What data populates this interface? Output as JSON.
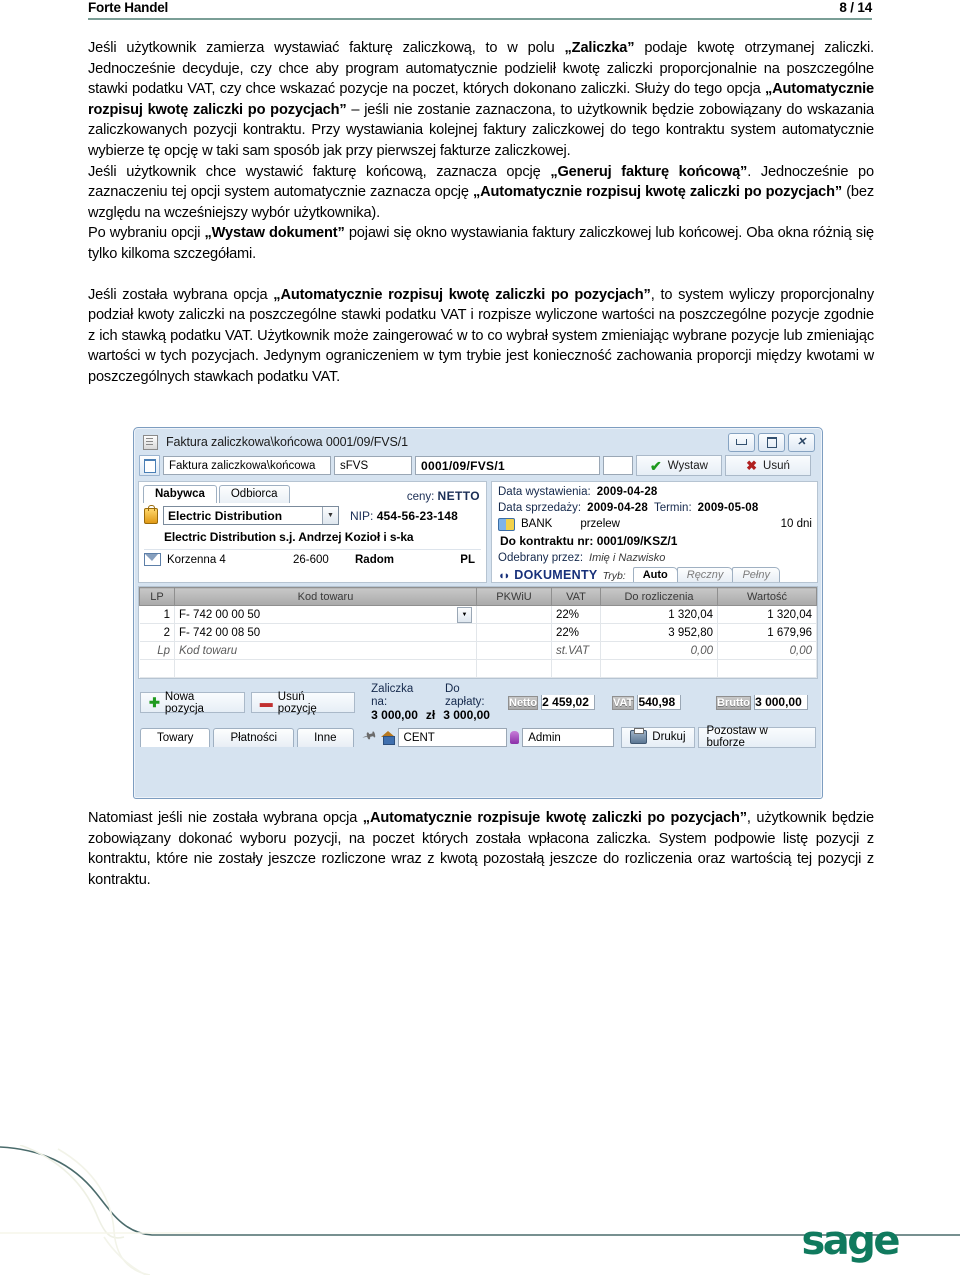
{
  "header": {
    "doc_title": "Forte Handel",
    "page_number": "8 / 14"
  },
  "paragraphs": {
    "p1_a": "Jeśli użytkownik zamierza wystawiać fakturę zaliczkową, to w polu ",
    "p1_b": "„Zaliczka”",
    "p1_c": " podaje kwotę otrzymanej zaliczki. Jednocześnie decyduje, czy chce aby program automatycznie podzielił kwotę zaliczki proporcjonalnie na poszczególne stawki podatku VAT, czy chce wskazać pozycje na poczet, których dokonano zaliczki. Służy do tego opcja ",
    "p1_d": "„Automatycznie rozpisuj kwotę zaliczki po pozycjach”",
    "p1_e": " – jeśli nie zostanie zaznaczona, to użytkownik będzie zobowiązany do wskazania zaliczkowanych pozycji kontraktu. Przy wystawiania kolejnej faktury zaliczkowej do tego kontraktu system automatycznie wybierze tę opcję w taki sam sposób jak przy pierwszej fakturze zaliczkowej.",
    "p2_a": "Jeśli użytkownik chce wystawić fakturę końcową, zaznacza opcję ",
    "p2_b": "„Generuj fakturę końcową”",
    "p2_c": ". Jednocześnie po zaznaczeniu tej opcji system automatycznie zaznacza opcję ",
    "p2_d": "„Automatycznie rozpisuj kwotę zaliczki po pozycjach”",
    "p2_e": " (bez względu na wcześniejszy wybór użytkownika).",
    "p3_a": "Po wybraniu opcji ",
    "p3_b": "„Wystaw dokument”",
    "p3_c": " pojawi się okno wystawiania faktury zaliczkowej lub końcowej. Oba okna różnią się tylko kilkoma szczegółami.",
    "p4_a": "Jeśli została wybrana opcja ",
    "p4_b": "„Automatycznie rozpisuj kwotę zaliczki po pozycjach”",
    "p4_c": ", to system wyliczy proporcjonalny podział kwoty zaliczki na poszczególne stawki podatku VAT i rozpisze wyliczone wartości na poszczególne pozycje zgodnie z ich stawką podatku VAT. Użytkownik może zaingerować w to co wybrał system zmieniając wybrane pozycje lub zmieniając wartości w tych pozycjach. Jedynym ograniczeniem w tym trybie jest konieczność zachowania proporcji między kwotami w poszczególnych stawkach podatku VAT.",
    "p5_a": "Natomiast jeśli nie została wybrana opcja ",
    "p5_b": "„Automatycznie rozpisuje kwotę zaliczki po pozycjach”",
    "p5_c": ", użytkownik będzie zobowiązany dokonać wyboru pozycji, na poczet których została wpłacona zaliczka. System podpowie listę pozycji z kontraktu, które nie zostały jeszcze rozliczone wraz z kwotą pozostałą jeszcze do rozliczenia oraz wartością tej pozycji z kontraktu."
  },
  "app_window": {
    "title": "Faktura zaliczkowa\\końcowa 0001/09/FVS/1",
    "window_buttons": {
      "minimize": "minimize-icon",
      "maximize": "maximize-icon",
      "close": "✕"
    },
    "toolbar": {
      "doc_type": "Faktura zaliczkowa\\końcowa",
      "symbol": "sFVS",
      "number": "0001/09/FVS/1",
      "issue_button": "Wystaw",
      "delete_button": "Usuń"
    },
    "left_panel": {
      "tabs": [
        {
          "label": "Nabywca",
          "active": true
        },
        {
          "label": "Odbiorca",
          "active": false
        }
      ],
      "prices_label": "ceny:",
      "prices_value": "NETTO",
      "contractor": "Electric Distribution",
      "nip_label": "NIP:",
      "nip_value": "454-56-23-148",
      "full_name": "Electric Distribution s.j. Andrzej Kozioł i s-ka",
      "street": "Korzenna 4",
      "postcode": "26-600",
      "city": "Radom",
      "country": "PL"
    },
    "right_panel": {
      "issue_date_label": "Data wystawienia:",
      "issue_date_value": "2009-04-28",
      "sale_date_label": "Data sprzedaży:",
      "sale_date_value": "2009-04-28",
      "term_label": "Termin:",
      "term_value": "2009-05-08",
      "payment_method": "BANK",
      "payment_type": "przelew",
      "payment_days": "10 dni",
      "contract_label": "Do kontraktu nr:",
      "contract_value": "0001/09/KSZ/1",
      "received_by_label": "Odebrany przez:",
      "received_by_value": "Imię i Nazwisko",
      "documents_label": "DOKUMENTY",
      "mode_label": "Tryb:",
      "mode_tabs": [
        {
          "label": "Auto",
          "active": true
        },
        {
          "label": "Ręczny",
          "active": false
        },
        {
          "label": "Pełny",
          "active": false
        }
      ]
    },
    "grid": {
      "columns": [
        "LP",
        "Kod towaru",
        "PKWiU",
        "VAT",
        "Do rozliczenia",
        "Wartość"
      ],
      "rows": [
        {
          "lp": "1",
          "kod": "F- 742 00 00 50",
          "pkwiu": "",
          "vat": "22%",
          "do_rozliczenia": "1 320,04",
          "wartosc": "1 320,04"
        },
        {
          "lp": "2",
          "kod": "F- 742 00 08 50",
          "pkwiu": "",
          "vat": "22%",
          "do_rozliczenia": "3 952,80",
          "wartosc": "1 679,96"
        }
      ],
      "ghost_row": {
        "lp": "Lp",
        "kod": "Kod towaru",
        "pkwiu": "",
        "vat": "st.VAT",
        "do_rozliczenia": "0,00",
        "wartosc": "0,00"
      }
    },
    "footer": {
      "new_item_button": "Nowa pozycja",
      "delete_item_button": "Usuń pozycję",
      "advance_label": "Zaliczka na:",
      "advance_value": "3 000,00",
      "advance_currency": "zł",
      "topay_label": "Do zapłaty:",
      "topay_value": "3 000,00",
      "totals": [
        {
          "label": "Netto",
          "value": "2 459,02"
        },
        {
          "label": "VAT",
          "value": "540,98"
        },
        {
          "label": "Brutto",
          "value": "3 000,00"
        }
      ],
      "tabs": [
        {
          "label": "Towary",
          "active": true
        },
        {
          "label": "Płatności",
          "active": false
        },
        {
          "label": "Inne",
          "active": false
        }
      ],
      "center_field": "CENT",
      "user_field": "Admin",
      "print_button": "Drukuj",
      "buffer_button": "Pozostaw w buforze"
    }
  },
  "footer_logo": {
    "text": "sage",
    "color": "#107a5e"
  }
}
